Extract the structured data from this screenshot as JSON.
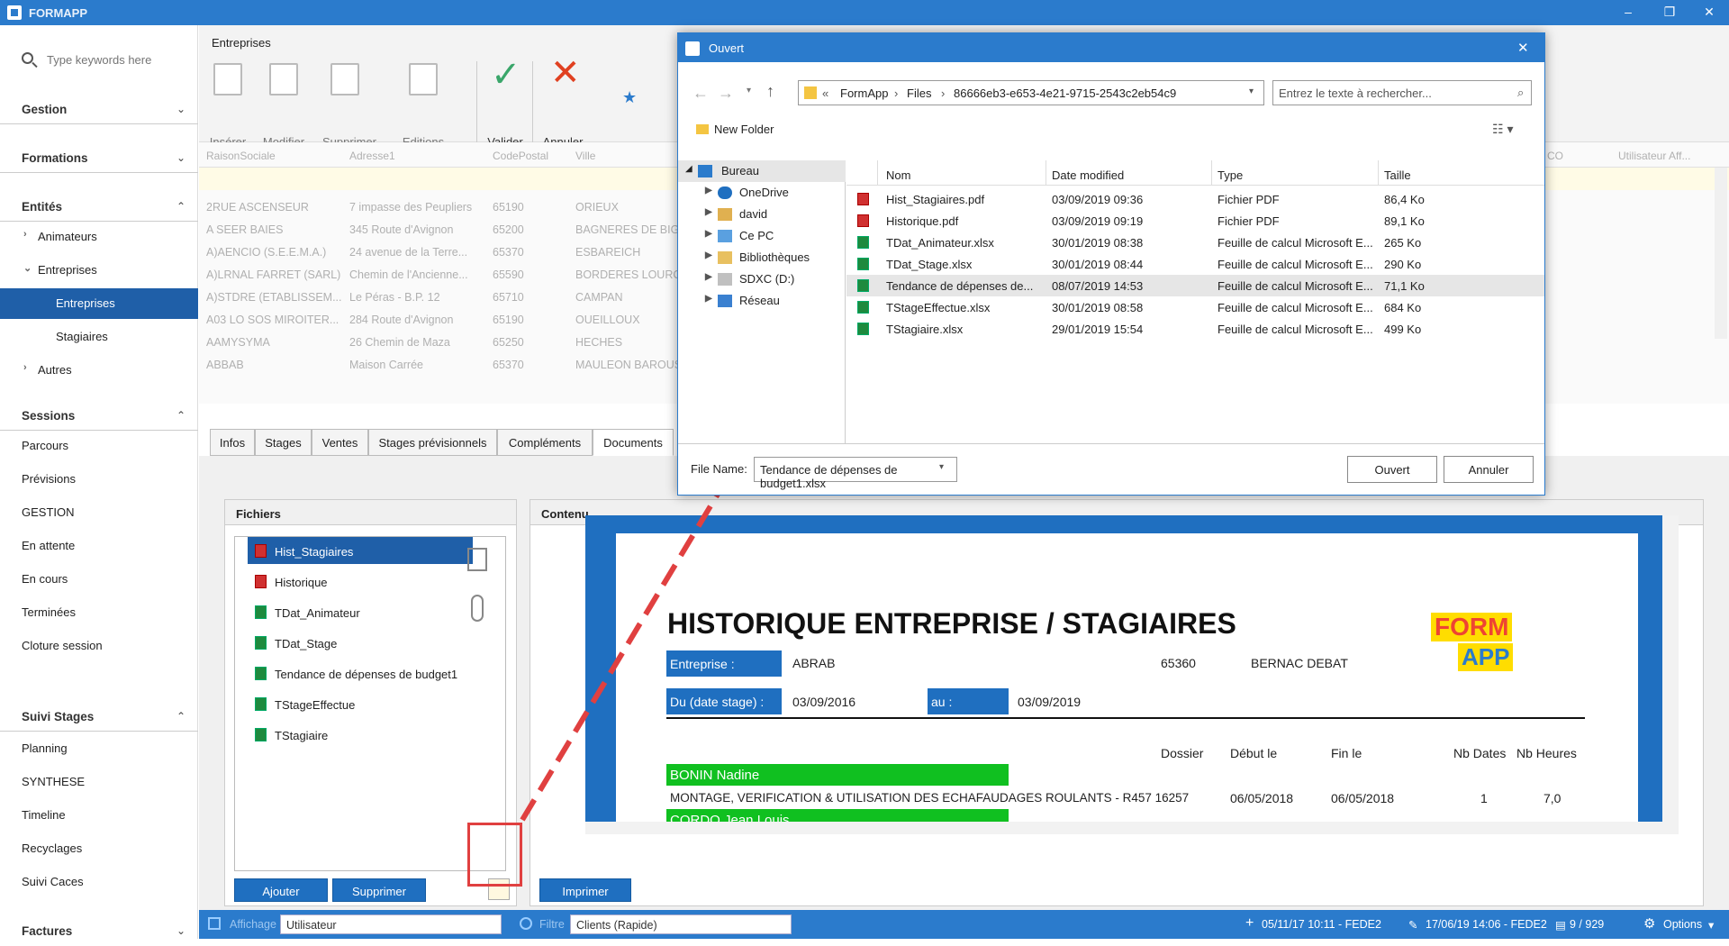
{
  "app": {
    "title": "FORMAPP"
  },
  "sidebar": {
    "search_placeholder": "Type keywords here",
    "sections": [
      {
        "label": "Gestion"
      },
      {
        "label": "Formations"
      },
      {
        "label": "Entités"
      },
      {
        "label": "Sessions"
      },
      {
        "label": "Suivi Stages"
      },
      {
        "label": "Factures"
      }
    ],
    "entites_items": [
      "Animateurs",
      "Entreprises",
      "Entreprises",
      "Stagiaires",
      "Autres"
    ],
    "sessions_items": [
      "Parcours",
      "Prévisions",
      "GESTION",
      "En attente",
      "En cours",
      "Terminées",
      "Cloture session"
    ],
    "suivi_items": [
      "Planning",
      "SYNTHESE",
      "Timeline",
      "Recyclages",
      "Suivi Caces"
    ]
  },
  "ribbon": {
    "title": "Entreprises",
    "buttons": [
      "Insérer",
      "Modifier",
      "Supprimer",
      "Editions",
      "Valider",
      "Annuler"
    ]
  },
  "grid": {
    "headers": [
      "RaisonSociale",
      "Adresse1",
      "CodePostal",
      "Ville",
      "CO",
      "Utilisateur Aff..."
    ],
    "rows": [
      [
        "2RUE ASCENSEUR",
        "7 impasse des Peupliers",
        "65190",
        "ORIEUX"
      ],
      [
        "A SEER BAIES",
        "345 Route d'Avignon",
        "65200",
        "BAGNERES DE BIGO"
      ],
      [
        "A)AENCIO (S.E.E.M.A.)",
        "24 avenue de la Terre...",
        "65370",
        "ESBAREICH"
      ],
      [
        "A)LRNAL FARRET (SARL)",
        "Chemin de l'Ancienne...",
        "65590",
        "BORDERES LOURON"
      ],
      [
        "A)STDRE (ETABLISSEM...",
        "Le Péras - B.P. 12",
        "65710",
        "CAMPAN"
      ],
      [
        "A03 LO SOS MIROITER...",
        "284 Route d'Avignon",
        "65190",
        "OUEILLOUX"
      ],
      [
        "AAMYSYMA",
        "26 Chemin de Maza",
        "65250",
        "HECHES"
      ],
      [
        "ABBAB",
        "Maison Carrée",
        "65370",
        "MAULEON BAROUSS"
      ]
    ]
  },
  "tabs": [
    "Infos",
    "Stages",
    "Ventes",
    "Stages prévisionnels",
    "Compléments",
    "Documents"
  ],
  "fichiers": {
    "title": "Fichiers",
    "files": [
      {
        "name": "Hist_Stagiaires",
        "kind": "pdf"
      },
      {
        "name": "Historique",
        "kind": "pdf"
      },
      {
        "name": "TDat_Animateur",
        "kind": "xlsx"
      },
      {
        "name": "TDat_Stage",
        "kind": "xlsx"
      },
      {
        "name": "Tendance de dépenses de budget1",
        "kind": "xlsx"
      },
      {
        "name": "TStageEffectue",
        "kind": "xlsx"
      },
      {
        "name": "TStagiaire",
        "kind": "xlsx"
      }
    ],
    "add": "Ajouter",
    "delete": "Supprimer"
  },
  "contenu": {
    "title": "Contenu",
    "print": "Imprimer",
    "doc": {
      "heading": "HISTORIQUE ENTREPRISE / STAGIAIRES",
      "logo_top": "FORM",
      "logo_bottom": "APP",
      "entreprise_label": "Entreprise :",
      "entreprise_value": "ABRAB",
      "cp": "65360",
      "ville": "BERNAC DEBAT",
      "du_label": "Du (date stage) :",
      "du_value": "03/09/2016",
      "au_label": "au :",
      "au_value": "03/09/2019",
      "cols": [
        "Dossier",
        "Début le",
        "Fin le",
        "Nb Dates",
        "Nb Heures"
      ],
      "person1": "BONIN Nadine",
      "stage1": "MONTAGE, VERIFICATION & UTILISATION DES ECHAFAUDAGES ROULANTS - R457 16257",
      "debut1": "06/05/2018",
      "fin1": "06/05/2018",
      "dates1": "1",
      "heures1": "7,0",
      "person2": "CORDO Jean Louis"
    }
  },
  "statusbar": {
    "affichage_label": "Affichage",
    "affichage_value": "Utilisateur",
    "filtre_label": "Filtre",
    "filtre_value": "Clients (Rapide)",
    "created": "05/11/17 10:11 - FEDE2",
    "modified": "17/06/19 14:06 - FEDE2",
    "records": "9 / 929",
    "options": "Options"
  },
  "dialog": {
    "title": "Ouvert",
    "breadcrumb": [
      "FormApp",
      "Files",
      "86666eb3-e653-4e21-9715-2543c2eb54c9"
    ],
    "search_placeholder": "Entrez le texte à rechercher...",
    "new_folder": "New Folder",
    "tree": [
      "Bureau",
      "OneDrive",
      "david",
      "Ce PC",
      "Bibliothèques",
      "SDXC (D:)",
      "Réseau"
    ],
    "columns": [
      "Nom",
      "Date modified",
      "Type",
      "Taille"
    ],
    "files": [
      [
        "Hist_Stagiaires.pdf",
        "03/09/2019 09:36",
        "Fichier PDF",
        "86,4 Ko"
      ],
      [
        "Historique.pdf",
        "03/09/2019 09:19",
        "Fichier PDF",
        "89,1 Ko"
      ],
      [
        "TDat_Animateur.xlsx",
        "30/01/2019 08:38",
        "Feuille de calcul Microsoft E...",
        "265 Ko"
      ],
      [
        "TDat_Stage.xlsx",
        "30/01/2019 08:44",
        "Feuille de calcul Microsoft E...",
        "290 Ko"
      ],
      [
        "Tendance de dépenses de...",
        "08/07/2019 14:53",
        "Feuille de calcul Microsoft E...",
        "71,1 Ko"
      ],
      [
        "TStageEffectue.xlsx",
        "30/01/2019 08:58",
        "Feuille de calcul Microsoft E...",
        "684 Ko"
      ],
      [
        "TStagiaire.xlsx",
        "29/01/2019 15:54",
        "Feuille de calcul Microsoft E...",
        "499 Ko"
      ]
    ],
    "filename_label": "File Name:",
    "filename_value": "Tendance de dépenses de budget1.xlsx",
    "open_btn": "Ouvert",
    "cancel_btn": "Annuler"
  }
}
